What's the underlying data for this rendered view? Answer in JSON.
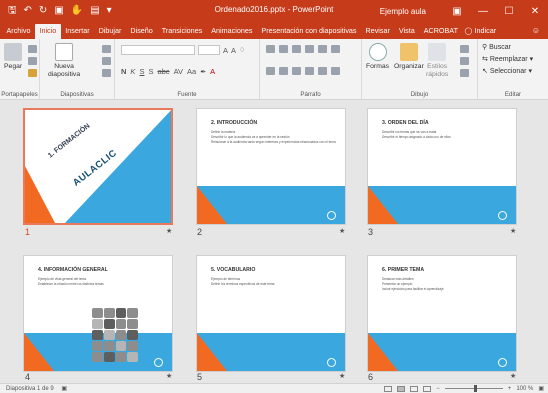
{
  "window": {
    "title": "Ordenado2016.pptx - PowerPoint",
    "user": "Ejemplo aula",
    "qat_icons": [
      "save-icon",
      "undo-icon",
      "redo-icon",
      "start-from-beginning-icon",
      "touch-mode-icon",
      "presentation-icon",
      "customize-qat-icon"
    ]
  },
  "tabs": [
    {
      "label": "Archivo",
      "active": false
    },
    {
      "label": "Inicio",
      "active": true
    },
    {
      "label": "Insertar",
      "active": false
    },
    {
      "label": "Dibujar",
      "active": false
    },
    {
      "label": "Diseño",
      "active": false
    },
    {
      "label": "Transiciones",
      "active": false
    },
    {
      "label": "Animaciones",
      "active": false
    },
    {
      "label": "Presentación con diapositivas",
      "active": false
    },
    {
      "label": "Revisar",
      "active": false
    },
    {
      "label": "Vista",
      "active": false
    },
    {
      "label": "ACROBAT",
      "active": false
    }
  ],
  "tell_me": "Indicar",
  "ribbon": {
    "groups": {
      "clipboard": "Portapapeles",
      "slides": "Diapositivas",
      "font": "Fuente",
      "paragraph": "Párrafo",
      "drawing": "Dibujo",
      "editing": "Editar"
    },
    "paste": "Pegar",
    "new_slide_line1": "Nueva",
    "new_slide_line2": "diapositiva",
    "format_buttons": [
      "N",
      "K",
      "S",
      "S",
      "abc",
      "AV",
      "Aa",
      "A"
    ],
    "font_size_buttons": [
      "A",
      "A"
    ],
    "shapes": "Formas",
    "arrange": "Organizar",
    "quick_styles_line1": "Estilos",
    "quick_styles_line2": "rápidos",
    "find": "Buscar",
    "replace": "Reemplazar",
    "select": "Seleccionar"
  },
  "slides": [
    {
      "number": "1",
      "selected": true,
      "kind": "title",
      "title_line1": "1. FORMACIÓN",
      "title_line2": "AULACLIC",
      "lines": []
    },
    {
      "number": "2",
      "selected": false,
      "kind": "content",
      "title": "2. INTRODUCCIÓN",
      "lines": [
        "Definir la materia",
        "Describir lo que la audiencia va a aprender en la sesión",
        "Relacionar a la audiencia tanto según intereses y experiencias relacionados con el tema"
      ]
    },
    {
      "number": "3",
      "selected": false,
      "kind": "content",
      "title": "3. ORDEN DEL DÍA",
      "lines": [
        "Describir los temas que se van a tratar",
        "Describir el tiempo asignado a cada uno de ellos"
      ]
    },
    {
      "number": "4",
      "selected": false,
      "kind": "image",
      "title": "4. INFORMACIÓN GENERAL",
      "lines": [
        "Ejemplo de vista general del tema",
        "Establecer la relación entre los distintos temas"
      ]
    },
    {
      "number": "5",
      "selected": false,
      "kind": "content",
      "title": "5. VOCABULARIO",
      "lines": [
        "Ejemplo de términos",
        "Definir los términos específicos de este tema"
      ]
    },
    {
      "number": "6",
      "selected": false,
      "kind": "content",
      "title": "6. PRIMER TEMA",
      "lines": [
        "Destacar más detalles",
        "Presentar un ejemplo",
        "Incluir ejercicios para facilitar el aprendizaje"
      ]
    }
  ],
  "status": {
    "slide_count": "Diapositiva 1 de 9",
    "zoom": "100 %",
    "zoom_fraction": 0.5
  },
  "colors": {
    "accent": "#c63b1a",
    "slide_blue": "#3aa8de",
    "slide_orange": "#f26a21",
    "selected_border": "#e8795b"
  }
}
